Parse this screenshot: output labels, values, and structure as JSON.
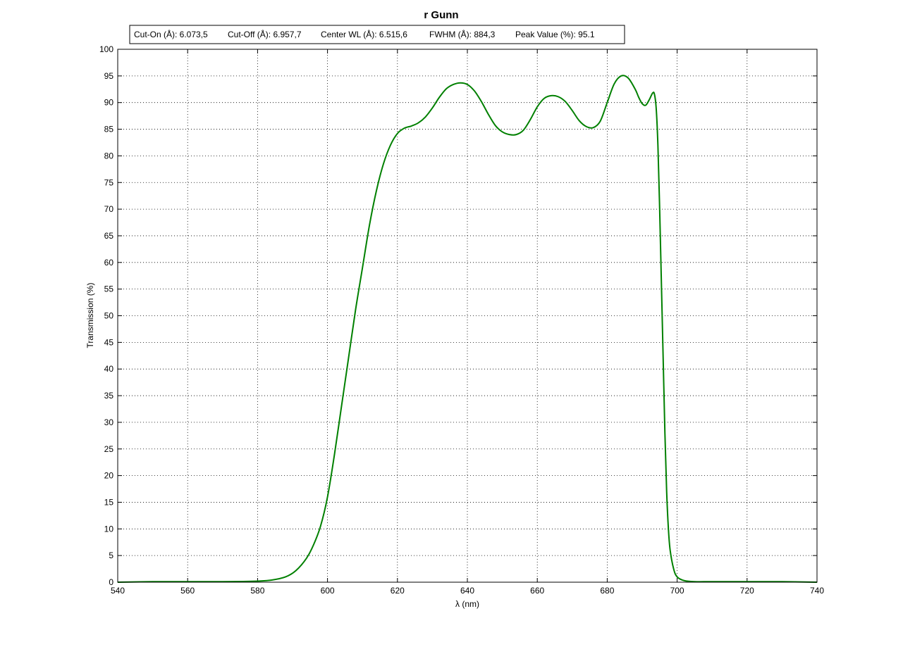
{
  "chart_data": {
    "type": "line",
    "title": "r Gunn",
    "xlabel": "λ (nm)",
    "ylabel": "Transmission (%)",
    "xlim": [
      540,
      740
    ],
    "ylim": [
      0,
      100
    ],
    "xticks": [
      540,
      560,
      580,
      600,
      620,
      640,
      660,
      680,
      700,
      720,
      740
    ],
    "yticks": [
      0,
      5,
      10,
      15,
      20,
      25,
      30,
      35,
      40,
      45,
      50,
      55,
      60,
      65,
      70,
      75,
      80,
      85,
      90,
      95,
      100
    ],
    "grid": true,
    "grid_style": "dotted",
    "line_color": "#008000",
    "info_box": {
      "cut_on": "Cut-On (Å): 6.073,5",
      "cut_off": "Cut-Off (Å): 6.957,7",
      "center_wl": "Center WL (Å): 6.515,6",
      "fwhm": "FWHM (Å): 884,3",
      "peak_value": "Peak Value (%): 95.1"
    },
    "series": [
      {
        "x": [
          540,
          550,
          560,
          570,
          580,
          584,
          588,
          591,
          594,
          596,
          598,
          600,
          602,
          604,
          606,
          608,
          610,
          612,
          614,
          616,
          618,
          620,
          622,
          624,
          626,
          628,
          630,
          632,
          634,
          636,
          638,
          640,
          642,
          644,
          646,
          648,
          650,
          652,
          654,
          656,
          658,
          660,
          662,
          664,
          666,
          668,
          670,
          672,
          674,
          676,
          678,
          680,
          682,
          684,
          686,
          688,
          689,
          690,
          691,
          692,
          693,
          693.5,
          694,
          694.5,
          695,
          695.5,
          696,
          696.5,
          697,
          697.5,
          698,
          699,
          700,
          702,
          705,
          710,
          720,
          730,
          740
        ],
        "y": [
          0,
          0.1,
          0.1,
          0.1,
          0.2,
          0.4,
          1.0,
          2.2,
          4.5,
          7,
          10.5,
          16,
          24,
          33,
          42,
          51,
          59,
          67,
          73.5,
          78.5,
          82,
          84.2,
          85.2,
          85.6,
          86.2,
          87.3,
          89,
          91,
          92.6,
          93.4,
          93.7,
          93.4,
          92.2,
          90.2,
          87.8,
          85.7,
          84.5,
          84.0,
          84.0,
          84.8,
          86.8,
          89.2,
          90.8,
          91.3,
          91.1,
          90.2,
          88.5,
          86.6,
          85.5,
          85.3,
          86.5,
          90,
          93.5,
          95,
          94.6,
          92.5,
          91,
          89.8,
          89.5,
          90.5,
          91.8,
          91.6,
          89,
          82,
          70,
          56,
          42,
          28,
          17,
          10,
          6,
          2.5,
          1,
          0.3,
          0.1,
          0.1,
          0.1,
          0.1,
          0
        ]
      }
    ]
  }
}
